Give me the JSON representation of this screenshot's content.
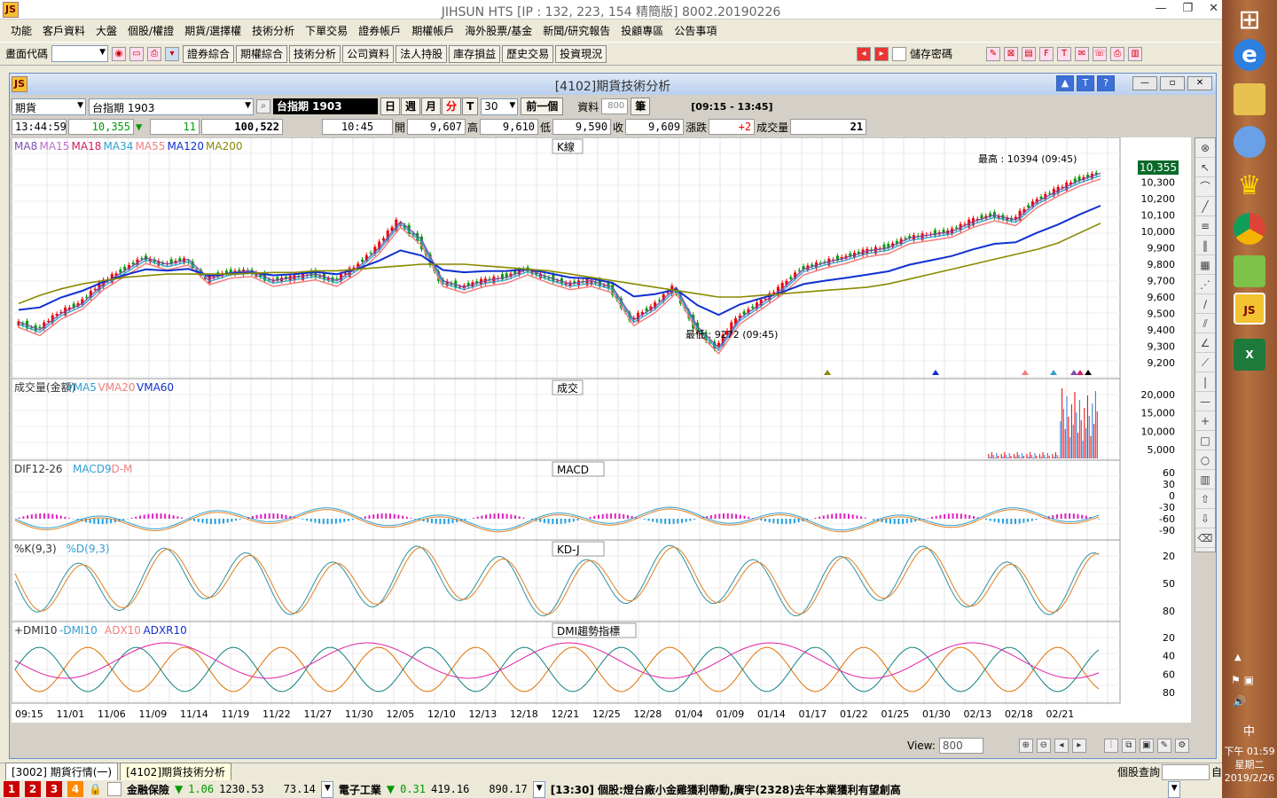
{
  "window": {
    "title": "JIHSUN HTS     [IP : 132, 223, 154 精簡版] 8002.20190226",
    "app_icon": "JS"
  },
  "menu": [
    "功能",
    "客戶資料",
    "大盤",
    "個股/權證",
    "期貨/選擇權",
    "技術分析",
    "下單交易",
    "證券帳戶",
    "期權帳戶",
    "海外股票/基金",
    "新聞/研究報告",
    "投顧專區",
    "公告事項"
  ],
  "toolbar": {
    "code_label": "畫面代碼",
    "buttons": [
      "證券綜合",
      "期權綜合",
      "技術分析",
      "公司資料",
      "法人持股",
      "庫存損益",
      "歷史交易",
      "投資現況"
    ],
    "save_pwd": "儲存密碼"
  },
  "child": {
    "title": "[4102]期貨技術分析"
  },
  "controls": {
    "market": "期貨",
    "symbol": "台指期 1903",
    "symbol_dark": "台指期 1903",
    "periods": [
      "日",
      "週",
      "月",
      "分",
      "T"
    ],
    "active_period": "分",
    "interval": "30",
    "prev_btn": "前一個",
    "data_label": "資料",
    "data_count": "800",
    "unit": "筆",
    "session": "[09:15 - 13:45]"
  },
  "quote": {
    "time": "13:44:59",
    "price": "10,355",
    "arrow": "▼",
    "change": "11",
    "volume_total": "100,522",
    "bar_time": "10:45",
    "open_label": "開",
    "open": "9,607",
    "high_label": "高",
    "high": "9,610",
    "low_label": "低",
    "low": "9,590",
    "close_label": "收",
    "close": "9,609",
    "chg_label": "漲跌",
    "chg": "+2",
    "vol_label": "成交量",
    "vol": "21"
  },
  "chart_data": {
    "type": "line",
    "panels": [
      {
        "name": "K線",
        "legend": [
          "MA8",
          "MA15",
          "MA18",
          "MA34",
          "MA55",
          "MA120",
          "MA200"
        ],
        "yticks": [
          9200,
          9300,
          9400,
          9500,
          9600,
          9700,
          9800,
          9900,
          10000,
          10100,
          10200,
          10300,
          10400
        ],
        "high_note": "最高 : 10394 (09:45)",
        "low_note": "最低 : 9272 (09:45)",
        "last": "10,355",
        "price_series": [
          9450,
          9400,
          9500,
          9560,
          9680,
          9760,
          9840,
          9800,
          9830,
          9710,
          9750,
          9760,
          9700,
          9720,
          9740,
          9700,
          9780,
          9900,
          10060,
          9950,
          9700,
          9660,
          9700,
          9720,
          9770,
          9720,
          9680,
          9700,
          9660,
          9460,
          9540,
          9660,
          9420,
          9290,
          9470,
          9560,
          9650,
          9770,
          9810,
          9840,
          9880,
          9900,
          9960,
          9980,
          10000,
          10060,
          10100,
          10070,
          10180,
          10250,
          10310,
          10355
        ],
        "ma_long_series": [
          9560,
          9610,
          9650,
          9680,
          9700,
          9720,
          9730,
          9740,
          9740,
          9740,
          9740,
          9745,
          9750,
          9750,
          9760,
          9760,
          9770,
          9780,
          9790,
          9800,
          9800,
          9800,
          9790,
          9780,
          9770,
          9760,
          9740,
          9720,
          9700,
          9680,
          9660,
          9640,
          9620,
          9600,
          9600,
          9610,
          9620,
          9630,
          9640,
          9650,
          9660,
          9680,
          9710,
          9740,
          9770,
          9800,
          9830,
          9860,
          9890,
          9930,
          9990,
          10050
        ]
      },
      {
        "name": "成交",
        "legend": [
          "成交量(金額)",
          "VMA5",
          "VMA20",
          "VMA60"
        ],
        "yticks": [
          "5,000",
          "10,000",
          "15,000",
          "20,000"
        ]
      },
      {
        "name": "MACD",
        "legend": [
          "DIF12-26",
          "MACD9",
          "D-M"
        ],
        "yticks": [
          "60",
          "30",
          "0",
          "-30",
          "-60",
          "-90"
        ]
      },
      {
        "name": "KD-J",
        "legend": [
          "%K(9,3)",
          "%D(9,3)"
        ],
        "yticks": [
          "80",
          "50",
          "20"
        ]
      },
      {
        "name": "DMI趨勢指標",
        "legend": [
          "+DMI10",
          "-DMI10",
          "ADX10",
          "ADXR10"
        ],
        "yticks": [
          "80",
          "60",
          "40",
          "20"
        ]
      }
    ],
    "x_labels": [
      "09:15",
      "11/01",
      "11/06",
      "11/09",
      "11/14",
      "11/19",
      "11/22",
      "11/27",
      "11/30",
      "12/05",
      "12/10",
      "12/13",
      "12/18",
      "12/21",
      "12/25",
      "12/28",
      "01/04",
      "01/09",
      "01/14",
      "01/17",
      "01/22",
      "01/25",
      "01/30",
      "02/13",
      "02/18",
      "02/21"
    ]
  },
  "view": {
    "label": "View:",
    "value": "800"
  },
  "tabs": [
    "[3002] 期貨行情(一)",
    "[4102]期貨技術分析"
  ],
  "search": {
    "label": "個股查詢",
    "btn": "自"
  },
  "status": {
    "nums": [
      "1",
      "2",
      "3",
      "4"
    ],
    "idx1_name": "金融保險",
    "idx1_arrow": "▼",
    "idx1_chg": "1.06",
    "idx1_val": "1230.53",
    "idx1_vol": "73.14",
    "idx2_name": "電子工業",
    "idx2_arrow": "▼",
    "idx2_chg": "0.31",
    "idx2_val": "419.16",
    "idx2_vol": "890.17",
    "news": "[13:30] 個股:燈台廠小金雞獲利帶動,廣宇(2328)去年本業獲利有望創高"
  },
  "clock": {
    "ime": "中",
    "time": "下午 01:59",
    "day": "星期二",
    "date": "2019/2/26"
  },
  "colors": {
    "accent": "#3b6fd6",
    "up": "#e00000",
    "down": "#009040"
  }
}
